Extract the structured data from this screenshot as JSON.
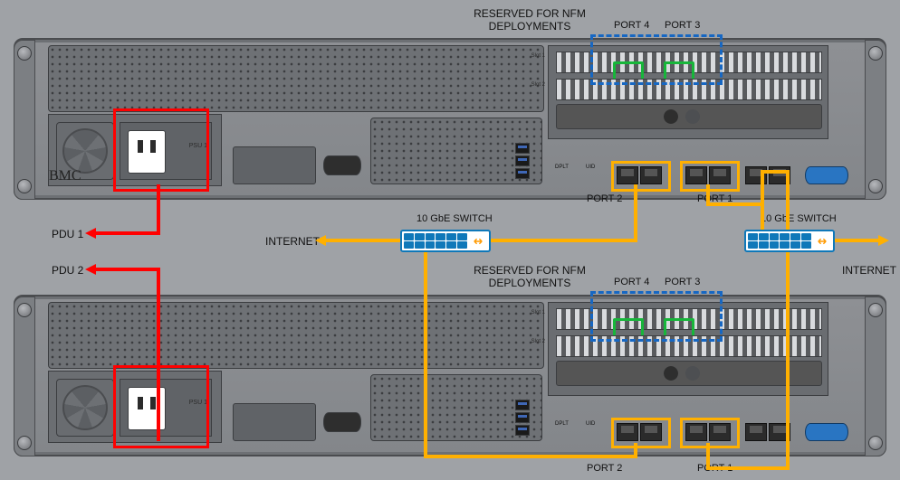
{
  "labels": {
    "reserved": "RESERVED FOR  NFM\nDEPLOYMENTS",
    "port1": "PORT 1",
    "port2": "PORT 2",
    "port3": "PORT 3",
    "port4": "PORT 4",
    "switch": "10 GbE SWITCH",
    "internet": "INTERNET",
    "pdu1": "PDU 1",
    "pdu2": "PDU 2",
    "bmc": "BMC",
    "psu1": "PSU 1",
    "slot1": "Slot 1",
    "slot2": "Slot 2",
    "dplt": "DPLT",
    "uid": "UID"
  }
}
